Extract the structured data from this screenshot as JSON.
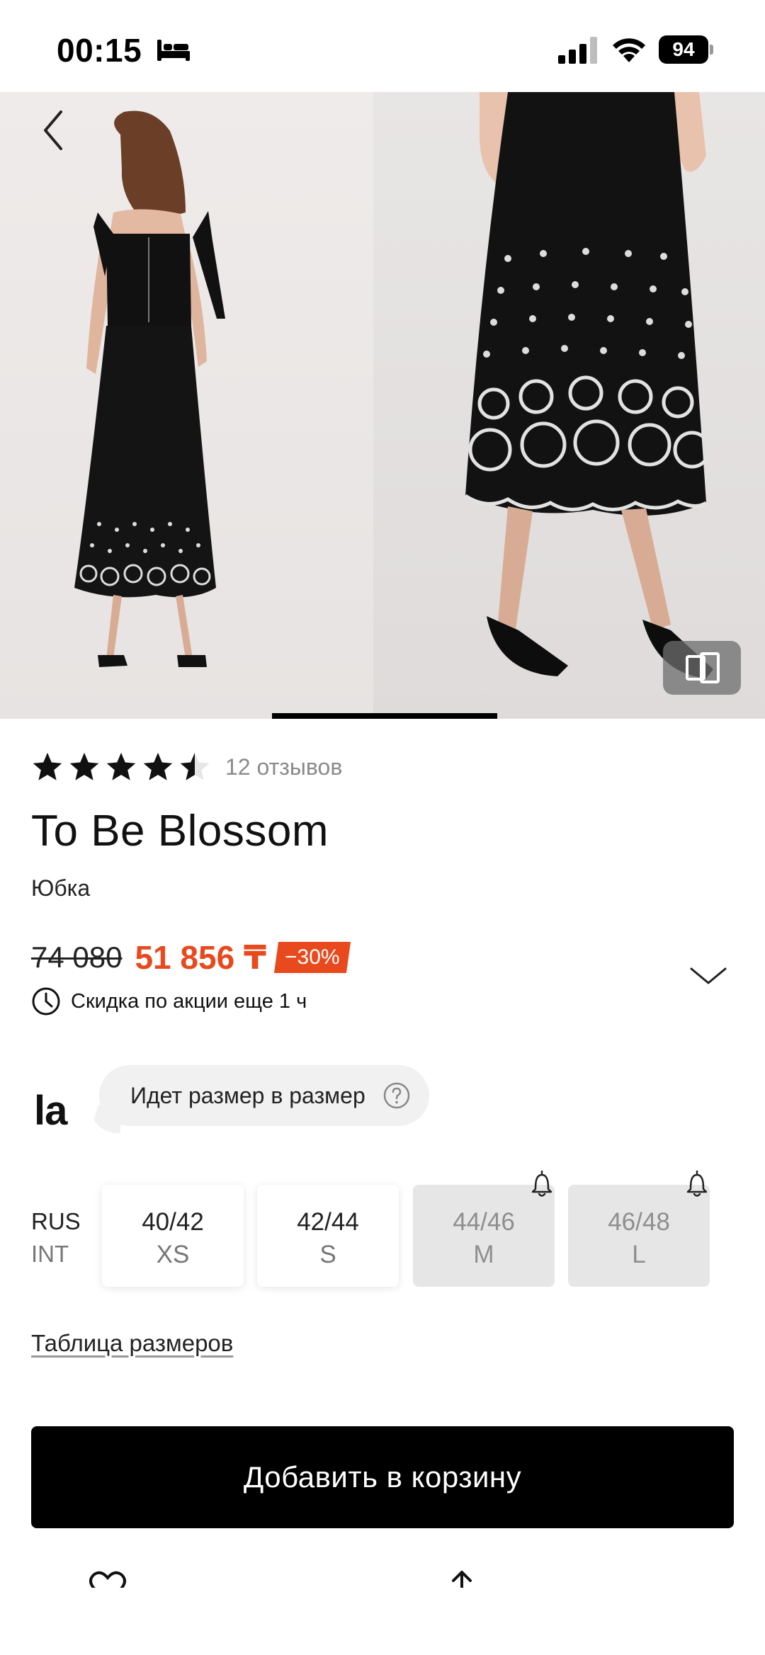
{
  "status_bar": {
    "time": "00:15",
    "battery": "94",
    "icons": [
      "bed-icon",
      "signal-icon",
      "wifi-icon",
      "battery-icon"
    ]
  },
  "gallery": {
    "images": [
      "model-back-view-photo",
      "skirt-hem-closeup-photo"
    ],
    "active_index": 0
  },
  "rating": {
    "stars": 4.5,
    "reviews_label": "12 отзывов"
  },
  "product": {
    "title": "To Be Blossom",
    "type": "Юбка"
  },
  "price": {
    "old": "74 080",
    "new": "51 856 ₸",
    "discount": "−30%",
    "promo_text": "Скидка по акции еще 1 ч"
  },
  "fit_tip": {
    "brand_logo": "la",
    "text": "Идет размер в размер"
  },
  "sizes": {
    "row_label_rus": "RUS",
    "row_label_int": "INT",
    "options": [
      {
        "rus": "40/42",
        "int": "XS",
        "available": true
      },
      {
        "rus": "42/44",
        "int": "S",
        "available": true
      },
      {
        "rus": "44/46",
        "int": "M",
        "available": false
      },
      {
        "rus": "46/48",
        "int": "L",
        "available": false
      }
    ]
  },
  "size_chart_link": "Таблица размеров",
  "add_to_cart": "Добавить в корзину",
  "colors": {
    "accent": "#e8491d",
    "primary_button": "#000000",
    "unavailable_size_bg": "#e6e6e6"
  }
}
